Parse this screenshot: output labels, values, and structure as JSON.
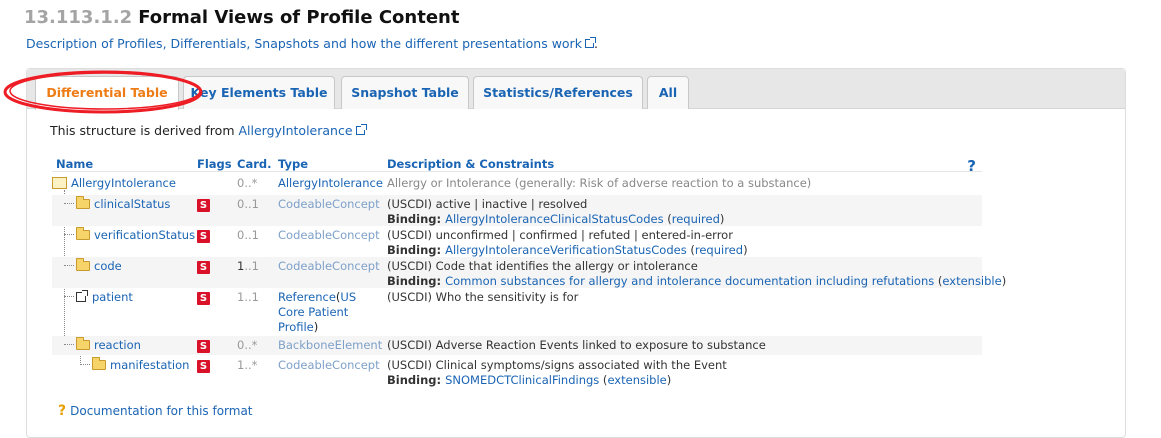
{
  "section": {
    "number": "13.113.1.2",
    "title": "Formal Views of Profile Content",
    "description_link": "Description of Profiles, Differentials, Snapshots and how the different presentations work",
    "description_suffix": "."
  },
  "tabs": [
    {
      "label": "Differential Table",
      "active": true
    },
    {
      "label": "Key Elements Table",
      "active": false
    },
    {
      "label": "Snapshot Table",
      "active": false
    },
    {
      "label": "Statistics/References",
      "active": false
    },
    {
      "label": "All",
      "active": false
    }
  ],
  "derived": {
    "prefix": "This structure is derived from ",
    "link": "AllergyIntolerance"
  },
  "table": {
    "headers": {
      "name": "Name",
      "flags": "Flags",
      "card": "Card.",
      "type": "Type",
      "desc": "Description & Constraints"
    },
    "rows": [
      {
        "name": "AllergyIntolerance",
        "flag": "",
        "card": "0..*",
        "type": "AllergyIntolerance",
        "desc": "Allergy or Intolerance (generally: Risk of adverse reaction to a substance)"
      },
      {
        "name": "clinicalStatus",
        "flag": "S",
        "card": "0..1",
        "type": "CodeableConcept",
        "desc": "(USCDI) active | inactive | resolved",
        "binding_label": "Binding: ",
        "binding_link": "AllergyIntoleranceClinicalStatusCodes",
        "binding_strength": "required"
      },
      {
        "name": "verificationStatus",
        "flag": "S",
        "card": "0..1",
        "type": "CodeableConcept",
        "desc": "(USCDI) unconfirmed | confirmed | refuted | entered-in-error",
        "binding_label": "Binding: ",
        "binding_link": "AllergyIntoleranceVerificationStatusCodes",
        "binding_strength": "required"
      },
      {
        "name": "code",
        "flag": "S",
        "card_min": "1",
        "card_max": "..1",
        "type": "CodeableConcept",
        "desc": "(USCDI) Code that identifies the allergy or intolerance",
        "binding_label": "Binding: ",
        "binding_link": "Common substances for allergy and intolerance documentation including refutations",
        "binding_strength": "extensible"
      },
      {
        "name": "patient",
        "flag": "S",
        "card": "1..1",
        "type_ref": "Reference",
        "type_open": "(",
        "type_target_1": "US",
        "type_target_2": "Core Patient",
        "type_target_3": "Profile",
        "type_close": ")",
        "desc": "(USCDI) Who the sensitivity is for"
      },
      {
        "name": "reaction",
        "flag": "S",
        "card": "0..*",
        "type": "BackboneElement",
        "desc": "(USCDI) Adverse Reaction Events linked to exposure to substance"
      },
      {
        "name": "manifestation",
        "flag": "S",
        "card": "1..*",
        "type": "CodeableConcept",
        "desc": "(USCDI) Clinical symptoms/signs associated with the Event",
        "binding_label": "Binding: ",
        "binding_link": "SNOMEDCTClinicalFindings",
        "binding_strength": "extensible"
      }
    ]
  },
  "doc_link": "Documentation for this format",
  "icons": {
    "help": "help-question-icon",
    "external": "external-link-icon",
    "folder": "folder-icon",
    "resource": "resource-icon",
    "reference": "reference-icon"
  },
  "colors": {
    "link": "#1a64b4",
    "active_tab": "#ee7c16",
    "flag_bg": "#d9122a",
    "annotation": "#ee1c24"
  }
}
